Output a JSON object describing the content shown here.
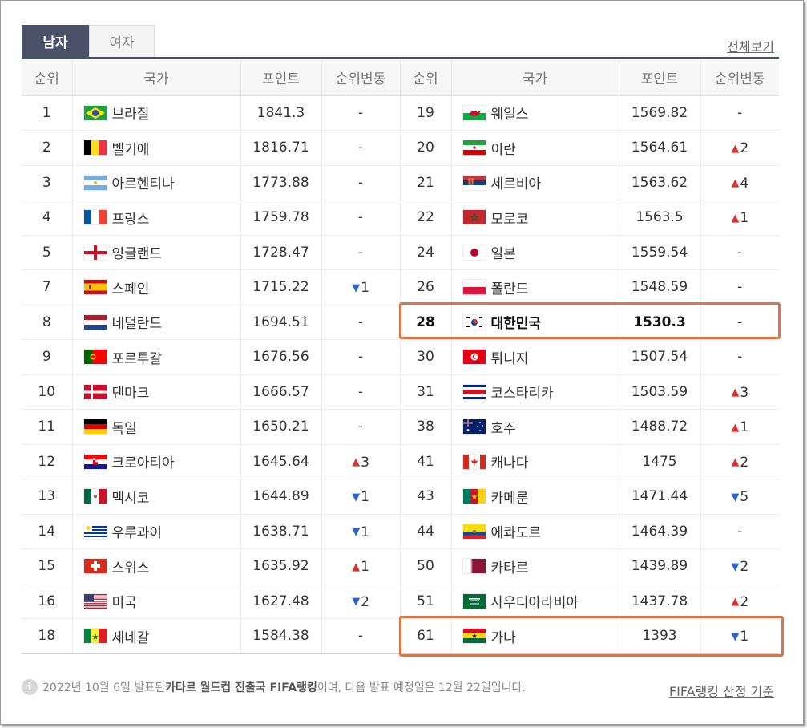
{
  "tabs": [
    {
      "label": "남자",
      "active": true
    },
    {
      "label": "여자",
      "active": false
    }
  ],
  "view_all": "전체보기",
  "headers": [
    "순위",
    "국가",
    "포인트",
    "순위변동",
    "순위",
    "국가",
    "포인트",
    "순위변동"
  ],
  "rows": [
    {
      "l": {
        "rank": "1",
        "name": "브라질",
        "flag": "flag-brazil",
        "points": "1841.3",
        "change": "-",
        "dir": ""
      },
      "r": {
        "rank": "19",
        "name": "웨일스",
        "flag": "flag-wales",
        "points": "1569.82",
        "change": "-",
        "dir": ""
      }
    },
    {
      "l": {
        "rank": "2",
        "name": "벨기에",
        "flag": "flag-belgium",
        "points": "1816.71",
        "change": "-",
        "dir": ""
      },
      "r": {
        "rank": "20",
        "name": "이란",
        "flag": "flag-iran",
        "points": "1564.61",
        "change": "2",
        "dir": "up"
      }
    },
    {
      "l": {
        "rank": "3",
        "name": "아르헨티나",
        "flag": "flag-argentina",
        "points": "1773.88",
        "change": "-",
        "dir": ""
      },
      "r": {
        "rank": "21",
        "name": "세르비아",
        "flag": "flag-serbia",
        "points": "1563.62",
        "change": "4",
        "dir": "up"
      }
    },
    {
      "l": {
        "rank": "4",
        "name": "프랑스",
        "flag": "flag-france",
        "points": "1759.78",
        "change": "-",
        "dir": ""
      },
      "r": {
        "rank": "22",
        "name": "모로코",
        "flag": "flag-morocco",
        "points": "1563.5",
        "change": "1",
        "dir": "up"
      }
    },
    {
      "l": {
        "rank": "5",
        "name": "잉글랜드",
        "flag": "flag-england",
        "points": "1728.47",
        "change": "-",
        "dir": ""
      },
      "r": {
        "rank": "24",
        "name": "일본",
        "flag": "flag-japan",
        "points": "1559.54",
        "change": "-",
        "dir": ""
      }
    },
    {
      "l": {
        "rank": "7",
        "name": "스페인",
        "flag": "flag-spain",
        "points": "1715.22",
        "change": "1",
        "dir": "down"
      },
      "r": {
        "rank": "26",
        "name": "폴란드",
        "flag": "flag-poland",
        "points": "1548.59",
        "change": "-",
        "dir": ""
      }
    },
    {
      "l": {
        "rank": "8",
        "name": "네덜란드",
        "flag": "flag-netherlands",
        "points": "1694.51",
        "change": "-",
        "dir": ""
      },
      "r": {
        "rank": "28",
        "name": "대한민국",
        "flag": "flag-korea",
        "points": "1530.3",
        "change": "-",
        "dir": ""
      }
    },
    {
      "l": {
        "rank": "9",
        "name": "포르투갈",
        "flag": "flag-portugal",
        "points": "1676.56",
        "change": "-",
        "dir": ""
      },
      "r": {
        "rank": "30",
        "name": "튀니지",
        "flag": "flag-tunisia",
        "points": "1507.54",
        "change": "-",
        "dir": ""
      }
    },
    {
      "l": {
        "rank": "10",
        "name": "덴마크",
        "flag": "flag-denmark",
        "points": "1666.57",
        "change": "-",
        "dir": ""
      },
      "r": {
        "rank": "31",
        "name": "코스타리카",
        "flag": "flag-costa-rica",
        "points": "1503.59",
        "change": "3",
        "dir": "up"
      }
    },
    {
      "l": {
        "rank": "11",
        "name": "독일",
        "flag": "flag-germany",
        "points": "1650.21",
        "change": "-",
        "dir": ""
      },
      "r": {
        "rank": "38",
        "name": "호주",
        "flag": "flag-australia",
        "points": "1488.72",
        "change": "1",
        "dir": "up"
      }
    },
    {
      "l": {
        "rank": "12",
        "name": "크로아티아",
        "flag": "flag-croatia",
        "points": "1645.64",
        "change": "3",
        "dir": "up"
      },
      "r": {
        "rank": "41",
        "name": "캐나다",
        "flag": "flag-canada",
        "points": "1475",
        "change": "2",
        "dir": "up"
      }
    },
    {
      "l": {
        "rank": "13",
        "name": "멕시코",
        "flag": "flag-mexico",
        "points": "1644.89",
        "change": "1",
        "dir": "down"
      },
      "r": {
        "rank": "43",
        "name": "카메룬",
        "flag": "flag-cameroon",
        "points": "1471.44",
        "change": "5",
        "dir": "down"
      }
    },
    {
      "l": {
        "rank": "14",
        "name": "우루과이",
        "flag": "flag-uruguay",
        "points": "1638.71",
        "change": "1",
        "dir": "down"
      },
      "r": {
        "rank": "44",
        "name": "에콰도르",
        "flag": "flag-ecuador",
        "points": "1464.39",
        "change": "-",
        "dir": ""
      }
    },
    {
      "l": {
        "rank": "15",
        "name": "스위스",
        "flag": "flag-switzerland",
        "points": "1635.92",
        "change": "1",
        "dir": "up"
      },
      "r": {
        "rank": "50",
        "name": "카타르",
        "flag": "flag-qatar",
        "points": "1439.89",
        "change": "2",
        "dir": "down"
      }
    },
    {
      "l": {
        "rank": "16",
        "name": "미국",
        "flag": "flag-usa",
        "points": "1627.48",
        "change": "2",
        "dir": "down"
      },
      "r": {
        "rank": "51",
        "name": "사우디아라비아",
        "flag": "flag-saudi-arabia",
        "points": "1437.78",
        "change": "2",
        "dir": "up"
      }
    },
    {
      "l": {
        "rank": "18",
        "name": "세네갈",
        "flag": "flag-senegal",
        "points": "1584.38",
        "change": "-",
        "dir": ""
      },
      "r": {
        "rank": "61",
        "name": "가나",
        "flag": "flag-ghana",
        "points": "1393",
        "change": "1",
        "dir": "down"
      }
    }
  ],
  "footnote": {
    "pre": "2022년 10월 6일 발표된 ",
    "bold": "카타르 월드컵 진출국 FIFA랭킹",
    "post": "이며, 다음 발표 예정일은 12월 22일입니다."
  },
  "criteria_link": "FIFA랭킹 산정 기준",
  "colors": {
    "tab_active": "#4a5068",
    "highlight_border": "#d9774a",
    "arrow_up": "#e0322b",
    "arrow_down": "#2a63d4"
  }
}
